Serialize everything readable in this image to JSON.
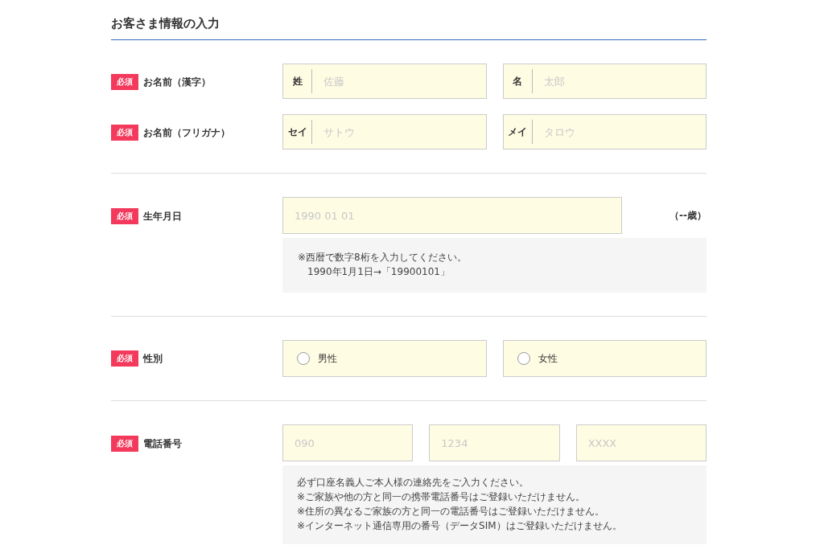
{
  "title": "お客さま情報の入力",
  "sections": [
    {
      "rows": [
        {
          "kind": "name",
          "required": "必須",
          "label": "お名前（漢字）",
          "fields": [
            {
              "prefix": "姓",
              "placeholder": "佐藤"
            },
            {
              "prefix": "名",
              "placeholder": "太郎"
            }
          ]
        },
        {
          "kind": "name",
          "required": "必須",
          "label": "お名前（フリガナ）",
          "fields": [
            {
              "prefix": "セイ",
              "placeholder": "サトウ"
            },
            {
              "prefix": "メイ",
              "placeholder": "タロウ"
            }
          ]
        }
      ]
    },
    {
      "rows": [
        {
          "kind": "birthday",
          "required": "必須",
          "label": "生年月日",
          "placeholder": "1990 01 01",
          "age": "（--歳）",
          "note": [
            "※西暦で数字8桁を入力してください。",
            "　1990年1月1日→「19900101」"
          ]
        }
      ]
    },
    {
      "rows": [
        {
          "kind": "radio",
          "required": "必須",
          "label": "性別",
          "options": [
            {
              "label": "男性",
              "selected": false
            },
            {
              "label": "女性",
              "selected": false
            }
          ]
        }
      ]
    },
    {
      "rows": [
        {
          "kind": "phone",
          "required": "必須",
          "label": "電話番号",
          "fields": [
            {
              "placeholder": "090"
            },
            {
              "placeholder": "1234"
            },
            {
              "placeholder": "XXXX"
            }
          ],
          "note": [
            "必ず口座名義人ご本人様の連絡先をご入力ください。",
            "※ご家族や他の方と同一の携帯電話番号はご登録いただけません。",
            "※住所の異なるご家族の方と同一の電話番号はご登録いただけません。",
            "※インターネット通信専用の番号（データSIM）はご登録いただけません。"
          ]
        }
      ]
    }
  ]
}
